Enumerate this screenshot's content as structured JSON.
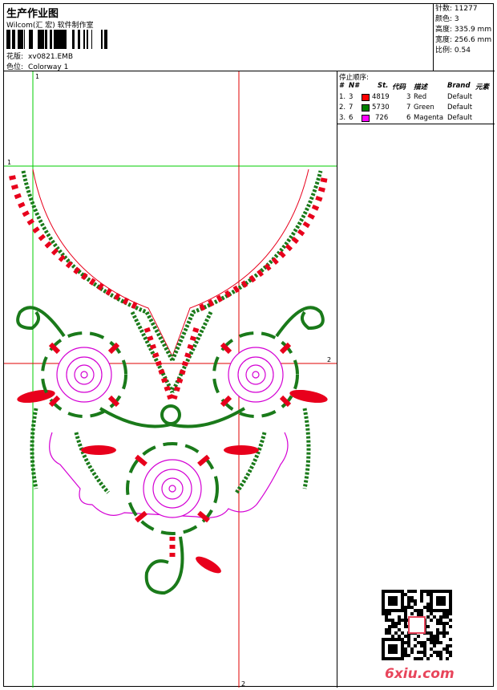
{
  "header": {
    "title": "生产作业图",
    "company": "Wilcom(汇 宏) 软件制作室",
    "design_label": "花版:",
    "design_file": "xv0821.EMB",
    "colorway_label": "色位:",
    "colorway": "Colorway 1"
  },
  "info": {
    "stitches_label": "针数:",
    "stitches": "11277",
    "colors_label": "颜色:",
    "colors": "3",
    "height_label": "高度:",
    "height": "335.9 mm",
    "width_label": "宽度:",
    "width": "256.6 mm",
    "scale_label": "比例:",
    "scale": "0.54"
  },
  "stop_sequence": {
    "title": "停止顺序:",
    "headers": [
      "#",
      "N#",
      "St.",
      "代码",
      "描述",
      "Brand",
      "元素"
    ],
    "rows": [
      {
        "n": "1.",
        "needle": "3",
        "color": "#ff0000",
        "stitches": "4819",
        "code": "3",
        "desc": "Red",
        "brand": "Default"
      },
      {
        "n": "2.",
        "needle": "7",
        "color": "#008000",
        "stitches": "5730",
        "code": "7",
        "desc": "Green",
        "brand": "Default"
      },
      {
        "n": "3.",
        "needle": "6",
        "color": "#ff00ff",
        "stitches": "726",
        "code": "6",
        "desc": "Magenta",
        "brand": "Default"
      }
    ]
  },
  "guides": {
    "v1": "1",
    "h1": "1",
    "v2": "2",
    "h2": "2"
  },
  "colors": {
    "red": "#e8001c",
    "green": "#1a7a1a",
    "magenta": "#d400d4",
    "guide_green": "#00cc00",
    "guide_red": "#e00000"
  },
  "watermark": "6xiu.com"
}
